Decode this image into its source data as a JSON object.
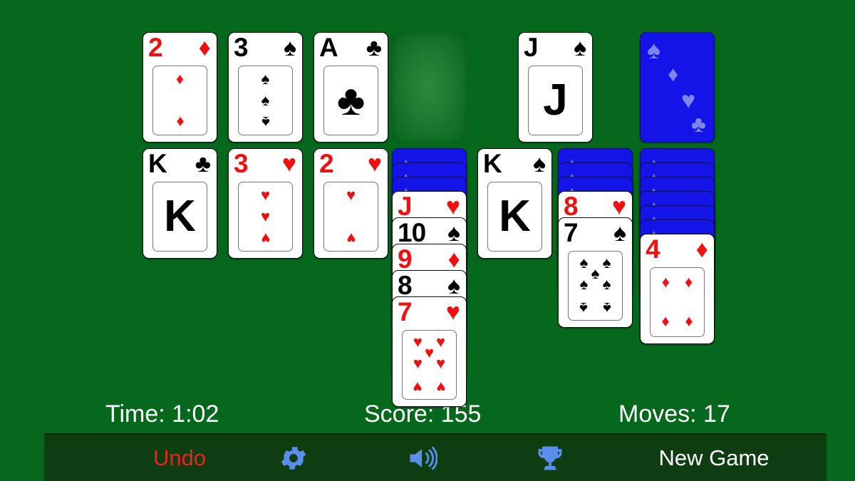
{
  "board": {
    "felt_color": "#06681d",
    "card_back_color": "#1414e8",
    "card_back_symbol_color": "#7d86f0",
    "red_suit_color": "#ee1111",
    "black_suit_color": "#000000"
  },
  "foundations": [
    {
      "name": "foundation-diamonds",
      "rank": "2",
      "suit": "♦",
      "color": "red",
      "pip_layout": "two",
      "state": "face-up"
    },
    {
      "name": "foundation-spades",
      "rank": "3",
      "suit": "♠",
      "color": "black",
      "pip_layout": "three",
      "state": "face-up"
    },
    {
      "name": "foundation-clubs",
      "rank": "A",
      "suit": "♣",
      "color": "black",
      "pip_layout": "ace",
      "state": "face-up"
    },
    {
      "name": "foundation-empty",
      "rank": "",
      "suit": "",
      "color": "",
      "pip_layout": "",
      "state": "empty"
    }
  ],
  "waste": {
    "name": "waste-pile",
    "rank": "J",
    "suit": "♠",
    "color": "black",
    "pip_layout": "letter",
    "state": "face-up"
  },
  "stock": {
    "name": "stock-pile",
    "state": "face-down",
    "back_suits": [
      "♠",
      "♦",
      "♥",
      "♣"
    ]
  },
  "tableau": [
    {
      "name": "tableau-column-1",
      "face_down": 0,
      "cards": [
        {
          "rank": "K",
          "suit": "♣",
          "color": "black",
          "pip_layout": "letter"
        }
      ]
    },
    {
      "name": "tableau-column-2",
      "face_down": 0,
      "cards": [
        {
          "rank": "3",
          "suit": "♥",
          "color": "red",
          "pip_layout": "three"
        }
      ]
    },
    {
      "name": "tableau-column-3",
      "face_down": 0,
      "cards": [
        {
          "rank": "2",
          "suit": "♥",
          "color": "red",
          "pip_layout": "two"
        }
      ]
    },
    {
      "name": "tableau-column-4",
      "face_down": 3,
      "cards": [
        {
          "rank": "J",
          "suit": "♥",
          "color": "red",
          "pip_layout": "hidden"
        },
        {
          "rank": "10",
          "suit": "♠",
          "color": "black",
          "pip_layout": "hidden"
        },
        {
          "rank": "9",
          "suit": "♦",
          "color": "red",
          "pip_layout": "hidden"
        },
        {
          "rank": "8",
          "suit": "♠",
          "color": "black",
          "pip_layout": "hidden"
        },
        {
          "rank": "7",
          "suit": "♥",
          "color": "red",
          "pip_layout": "seven"
        }
      ]
    },
    {
      "name": "tableau-column-5",
      "face_down": 0,
      "cards": [
        {
          "rank": "K",
          "suit": "♠",
          "color": "black",
          "pip_layout": "letter"
        }
      ]
    },
    {
      "name": "tableau-column-6",
      "face_down": 3,
      "cards": [
        {
          "rank": "8",
          "suit": "♥",
          "color": "red",
          "pip_layout": "hidden"
        },
        {
          "rank": "7",
          "suit": "♠",
          "color": "black",
          "pip_layout": "seven"
        }
      ]
    },
    {
      "name": "tableau-column-7",
      "face_down": 6,
      "cards": [
        {
          "rank": "4",
          "suit": "♦",
          "color": "red",
          "pip_layout": "four"
        }
      ]
    }
  ],
  "status": {
    "time_label": "Time: 1:02",
    "score_label": "Score: 155",
    "moves_label": "Moves: 17"
  },
  "toolbar": {
    "undo_label": "Undo",
    "settings_icon": "gear-icon",
    "sound_icon": "speaker-icon",
    "trophy_icon": "trophy-icon",
    "new_game_label": "New Game",
    "icon_color": "#5b8dea",
    "undo_color": "#ee2222",
    "background": "#0d3d11"
  }
}
